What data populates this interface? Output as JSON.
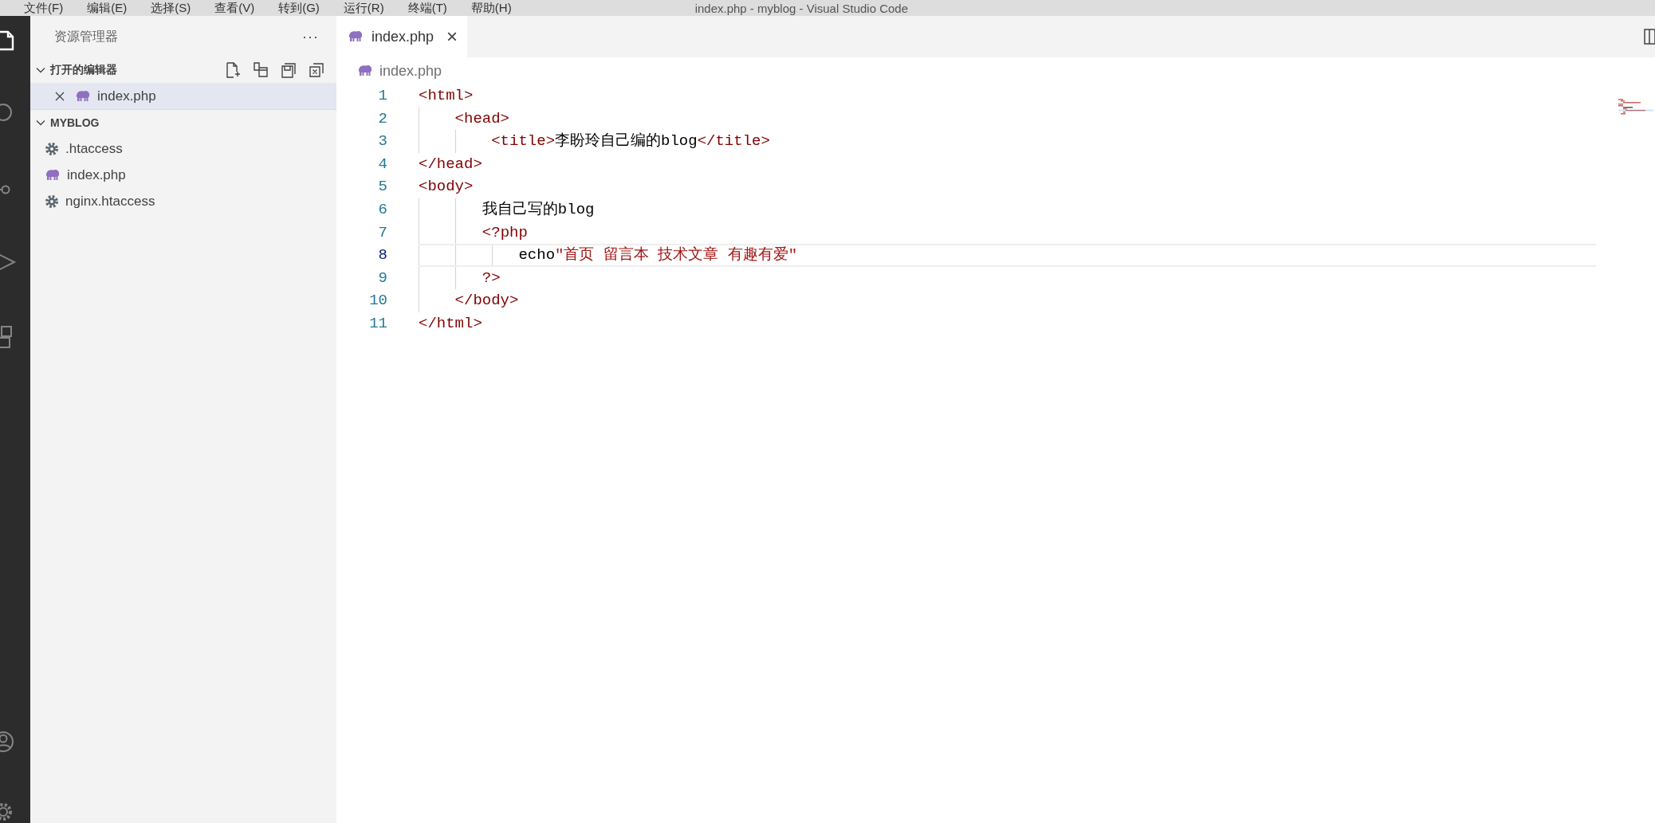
{
  "title_bar": {
    "menu": [
      "文件(F)",
      "编辑(E)",
      "选择(S)",
      "查看(V)",
      "转到(G)",
      "运行(R)",
      "终端(T)",
      "帮助(H)"
    ],
    "title": "index.php - myblog - Visual Studio Code"
  },
  "activity_bar": {
    "items": [
      {
        "kind": "explorer",
        "selected": true
      },
      {
        "kind": "search",
        "selected": false
      },
      {
        "kind": "source_control",
        "selected": false
      },
      {
        "kind": "run",
        "selected": false
      },
      {
        "kind": "extensions",
        "selected": false
      }
    ],
    "bottom": [
      {
        "kind": "account"
      },
      {
        "kind": "settings"
      }
    ]
  },
  "sidebar": {
    "title": "资源管理器",
    "more": "···",
    "sections": [
      {
        "title": "打开的编辑器",
        "kind": "open_editors",
        "expanded": true,
        "items": [
          {
            "name": "index.php",
            "kind": "php",
            "selected": true,
            "close": true
          }
        ]
      },
      {
        "title": "MYBLOG",
        "kind": "folder",
        "expanded": true,
        "items": [
          {
            "name": ".htaccess",
            "kind": "config",
            "selected": false,
            "close": false
          },
          {
            "name": "index.php",
            "kind": "php",
            "selected": false,
            "close": false
          },
          {
            "name": "nginx.htaccess",
            "kind": "config",
            "selected": false,
            "close": false
          }
        ]
      }
    ]
  },
  "tabs": [
    {
      "label": "index.php",
      "kind": "php",
      "selected": true,
      "close": "×"
    }
  ],
  "editor": {
    "breadcrumb": "index.php",
    "lines": [
      {
        "number": "1",
        "current": false,
        "tokens": [
          {
            "kind": "tag",
            "text": "<html>"
          }
        ]
      },
      {
        "number": "2",
        "current": false,
        "tokens": [
          {
            "kind": "tag",
            "text": "    <head>"
          }
        ]
      },
      {
        "number": "3",
        "current": false,
        "tokens": [
          {
            "kind": "tag",
            "text": "        <title>"
          },
          {
            "kind": "text",
            "text": "李盼玲自己编的blog"
          },
          {
            "kind": "tag",
            "text": "</title>"
          }
        ]
      },
      {
        "number": "4",
        "current": false,
        "tokens": [
          {
            "kind": "tag",
            "text": "</head>"
          }
        ]
      },
      {
        "number": "5",
        "current": false,
        "tokens": [
          {
            "kind": "tag",
            "text": "<body>"
          }
        ]
      },
      {
        "number": "6",
        "current": false,
        "tokens": [
          {
            "kind": "text",
            "text": "       我自己写的blog"
          }
        ]
      },
      {
        "number": "7",
        "current": false,
        "tokens": [
          {
            "kind": "tag",
            "text": "       <?php"
          }
        ]
      },
      {
        "number": "8",
        "current": true,
        "tokens": [
          {
            "kind": "text",
            "text": "           echo"
          },
          {
            "kind": "string",
            "text": "\"首页 留言本 技术文章 有趣有爱\""
          }
        ]
      },
      {
        "number": "9",
        "current": false,
        "tokens": [
          {
            "kind": "tag",
            "text": "       ?>"
          }
        ]
      },
      {
        "number": "10",
        "current": false,
        "tokens": [
          {
            "kind": "tag",
            "text": "    </body>"
          }
        ]
      },
      {
        "number": "11",
        "current": false,
        "tokens": [
          {
            "kind": "tag",
            "text": "</html>"
          }
        ]
      }
    ]
  }
}
